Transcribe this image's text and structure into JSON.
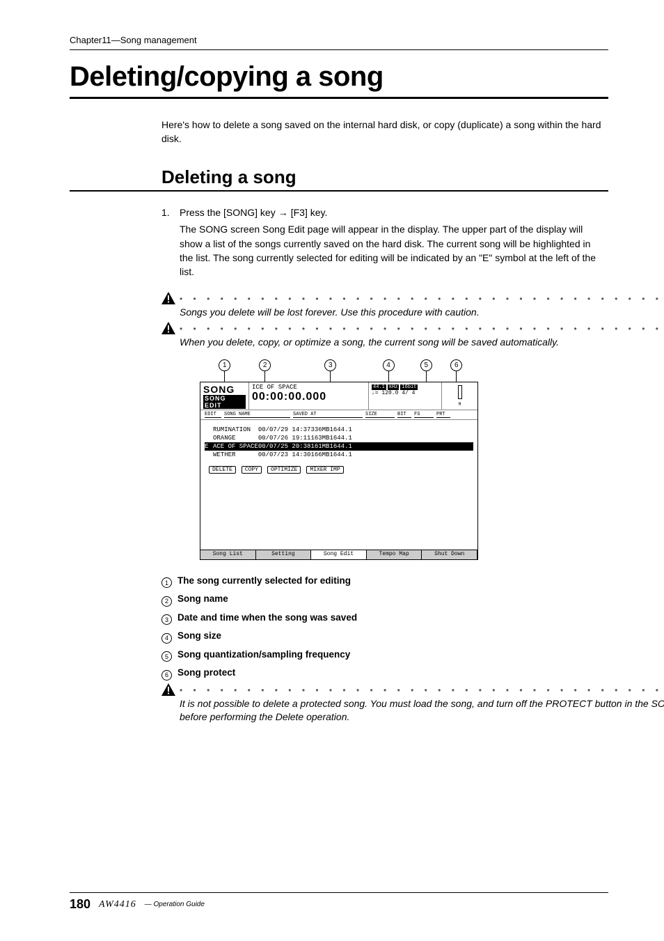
{
  "chapter_header": "Chapter11—Song management",
  "main_title": "Deleting/copying a song",
  "intro": "Here's how to delete a song saved on the internal hard disk, or copy (duplicate) a song within the hard disk.",
  "subtitle": "Deleting a song",
  "step1": {
    "num": "1.",
    "title_pre": "Press the [SONG] key",
    "title_post": "[F3] key.",
    "body": "The SONG screen Song Edit page will appear in the display. The upper part of the display will show a list of the songs currently saved on the hard disk. The current song will be highlighted in the list. The song currently selected for editing will be indicated by an \"E\" symbol at the left of the list."
  },
  "warning1": "Songs you delete will be lost forever. Use this procedure with caution.",
  "warning2": "When you delete, copy, or optimize a song, the current song will be saved automatically.",
  "warning3": "It is not possible to delete a protected song. You must load the song, and turn off the PROTECT button in the SONG screen Setting page before performing the Delete operation.",
  "callout_positions": {
    "c1": "6%",
    "c2": "22%",
    "c3": "46%",
    "c4": "69%",
    "c5": "82%",
    "c6": "94%"
  },
  "screenshot": {
    "logo_top": "SONG",
    "logo_bot": "SONG EDIT",
    "title_small": "ICE OF SPACE",
    "time_display": "00:00:00.000",
    "top_right_sr": "44.1",
    "top_right_kh": "kHz",
    "top_right_bit": "16bit",
    "top_right_tempo": "♩= 120.0",
    "top_right_sig": "4/ 4",
    "headers": {
      "edit": "EDIT",
      "name": "SONG NAME",
      "saved": "SAVED AT",
      "size": "SIZE",
      "bit": "BIT",
      "fs": "FS",
      "prt": "PRT"
    },
    "rows": [
      {
        "e": " ",
        "name": "RUMINATION  ",
        "date": "00/07/29 14:37",
        "size": "336MB",
        "bit": "16",
        "fs": "44.1",
        "sel": false
      },
      {
        "e": " ",
        "name": "ORANGE      ",
        "date": "00/07/26 19:11",
        "size": "163MB",
        "bit": "16",
        "fs": "44.1",
        "sel": false
      },
      {
        "e": "E",
        "name": "ACE OF SPACE",
        "date": "00/07/25 20:38",
        "size": "161MB",
        "bit": "16",
        "fs": "44.1",
        "sel": true
      },
      {
        "e": " ",
        "name": "WETHER      ",
        "date": "00/07/23 14:30",
        "size": "166MB",
        "bit": "16",
        "fs": "44.1",
        "sel": false
      }
    ],
    "buttons": {
      "delete": "DELETE",
      "copy": "COPY",
      "optimize": "OPTIMIZE",
      "mixer": "MIXER IMP"
    },
    "tabs": {
      "t1": "Song List",
      "t2": "Setting",
      "t3": "Song Edit",
      "t4": "Tempo Map",
      "t5": "Shut Down"
    }
  },
  "legend": {
    "l1": "The song currently selected for editing",
    "l2": "Song name",
    "l3": "Date and time when the song was saved",
    "l4": "Song size",
    "l5": "Song quantization/sampling frequency",
    "l6": "Song protect"
  },
  "footer": {
    "page": "180",
    "brand": "AW4416",
    "op": "— Operation Guide"
  }
}
